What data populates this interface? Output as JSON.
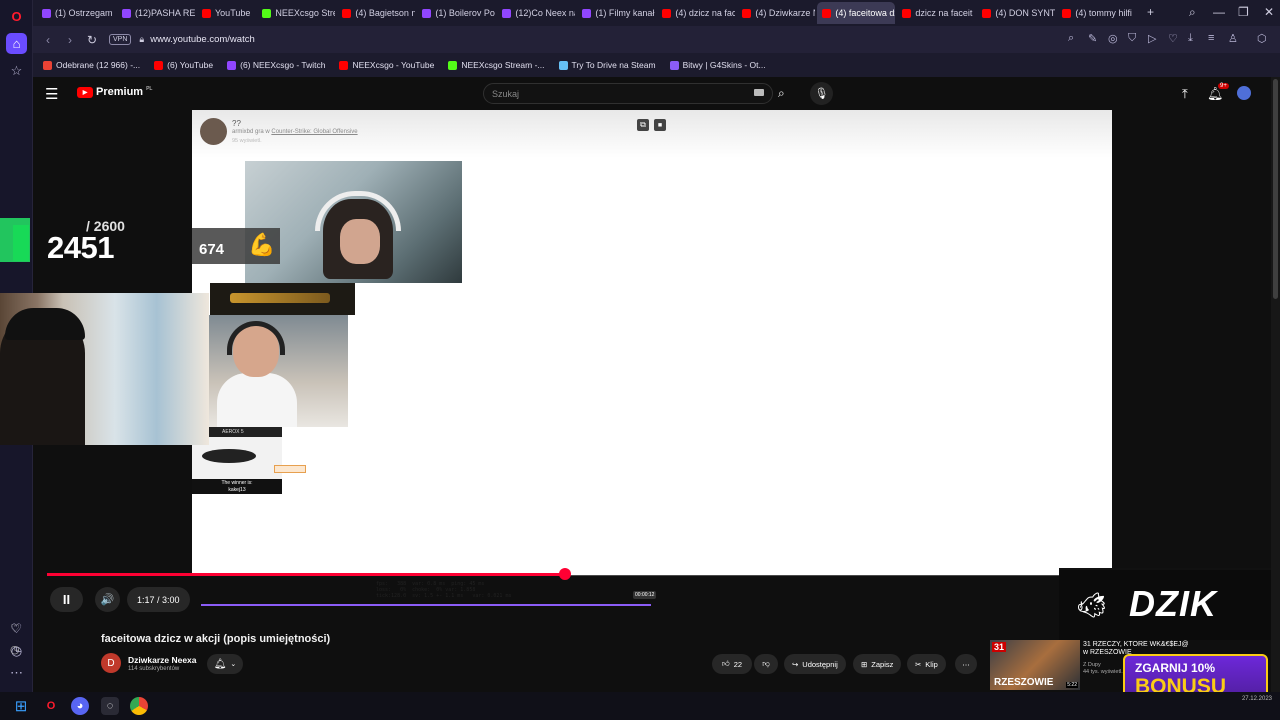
{
  "tabs": [
    {
      "label": "(1) Ostrzegam",
      "color": "#9146ff"
    },
    {
      "label": "(12)PASHA REA",
      "color": "#9146ff"
    },
    {
      "label": "YouTube",
      "color": "#ff0000"
    },
    {
      "label": "NEEXcsgo Stre",
      "color": "#53fc18"
    },
    {
      "label": "(4) Bagietson n",
      "color": "#ff0000"
    },
    {
      "label": "(1) Boilerov Po",
      "color": "#9146ff"
    },
    {
      "label": "(12)Co Neex na",
      "color": "#9146ff"
    },
    {
      "label": "(1) Filmy kanał",
      "color": "#9146ff"
    },
    {
      "label": "(4) dzicz na fac",
      "color": "#ff0000"
    },
    {
      "label": "(4) Dziwkarze N",
      "color": "#ff0000"
    },
    {
      "label": "(4) faceitowa dzicz w",
      "color": "#ff0000",
      "active": true
    },
    {
      "label": "dzicz na faceit",
      "color": "#ff0000"
    },
    {
      "label": "(4) DON SYNTI",
      "color": "#ff0000"
    },
    {
      "label": "(4) tommy hilfi",
      "color": "#ff0000"
    }
  ],
  "new_tab": "+",
  "window_controls": {
    "search": "⌕",
    "minimize": "—",
    "restore": "❐",
    "close": "✕"
  },
  "address": {
    "vpn": "VPN",
    "url": "www.youtube.com/watch"
  },
  "bookmarks": [
    {
      "label": "Odebrane (12 966) -...",
      "color": "#ea4335"
    },
    {
      "label": "(6) YouTube",
      "color": "#ff0000"
    },
    {
      "label": "(6) NEEXcsgo - Twitch",
      "color": "#9146ff"
    },
    {
      "label": "NEEXcsgo - YouTube",
      "color": "#ff0000"
    },
    {
      "label": "NEEXcsgo Stream -...",
      "color": "#53fc18"
    },
    {
      "label": "Try To Drive na Steam",
      "color": "#66c0f4"
    },
    {
      "label": "Bitwy | G4Skins - Ot...",
      "color": "#8b5cf6"
    }
  ],
  "yt": {
    "brand": "Premium",
    "region": "PL",
    "search_placeholder": "Szukaj",
    "notif_count": "9+"
  },
  "video_frame": {
    "title": "??",
    "subtitle_prefix": "armixbd gra w",
    "game": "Counter-Strike: Global Offensive",
    "views": "95 wyświetl."
  },
  "overlay": {
    "score_total": "/ 2600",
    "score_current": "2451",
    "badge_number": "674",
    "aerox_label": "AEROX 5",
    "winner_label": "The winner is:",
    "winner_name": "kakej13"
  },
  "stats_text": "fps:   388  var: 0.8 ms  ping: 45 ms\nloss:   0%  choke:  0% var: 1.858\ntick:128.0  sv: 1.5 +- 1.1 ms   var: 0.021 ms",
  "inner_time": "00:00:12",
  "player": {
    "progress": 0.42,
    "time": "1:17 / 3:00",
    "play_icon": "II",
    "vol_icon": "🔊"
  },
  "ad": {
    "brand": "DZIK",
    "bonus_line1": "ZGARNIJ 10%",
    "bonus_line2": "BONUSU"
  },
  "video": {
    "title": "faceitowa dzicz w akcji (popis umiejętności)",
    "channel_initial": "D",
    "channel": "Dziwkarze Neexa",
    "subscribers": "114 subskrybentów",
    "likes": "22",
    "share": "Udostępnij",
    "save": "Zapisz",
    "clip": "Klip",
    "more": "⋯"
  },
  "recommended": {
    "badge": "31",
    "thumb_text": "RZESZOWIE",
    "duration": "5:22",
    "title": "31 RZECZY, KTORE WK&€$EJ@ w RZESZOWIE",
    "channel": "Z Dupy",
    "views": "44 tys. wyświetl."
  },
  "taskbar": {
    "clock": "27.12.2023"
  }
}
